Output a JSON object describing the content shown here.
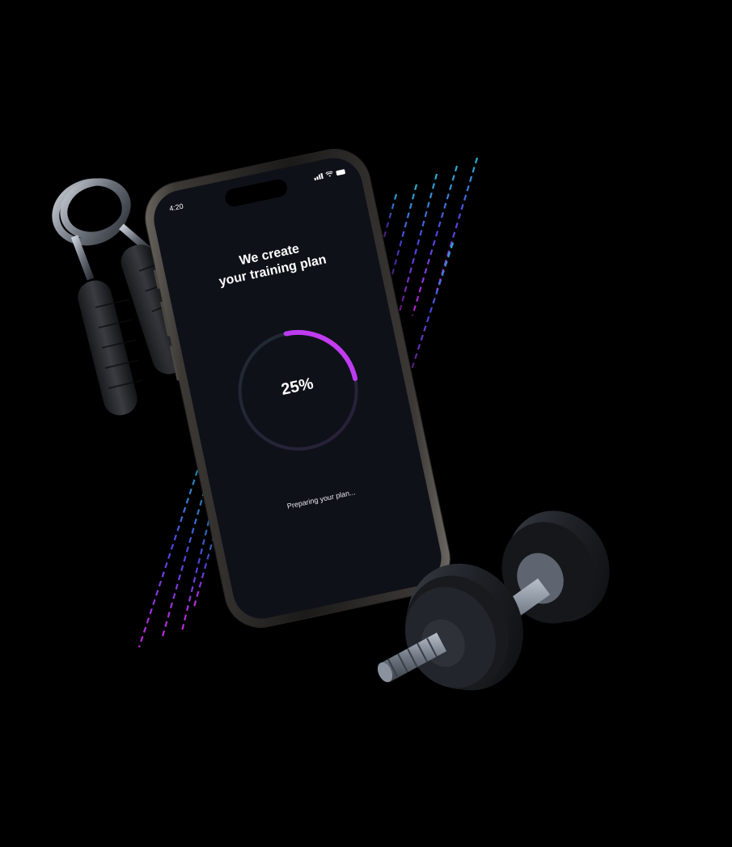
{
  "status_bar": {
    "time": "4:20"
  },
  "screen": {
    "title_line1": "We create",
    "title_line2": "your training plan",
    "progress_text": "25%",
    "progress_fraction": 0.25,
    "status_text": "Preparing your plan..."
  },
  "colors": {
    "progress_start": "#6a3cf5",
    "progress_end": "#d23cf0",
    "track": "#1f2a36",
    "screen_bg": "#0f1119",
    "stripe_top": "#2aa0c8",
    "stripe_bottom": "#c02cd8"
  },
  "icons": [
    "signal-icon",
    "wifi-icon",
    "battery-icon",
    "hand-gripper",
    "dumbbell"
  ]
}
